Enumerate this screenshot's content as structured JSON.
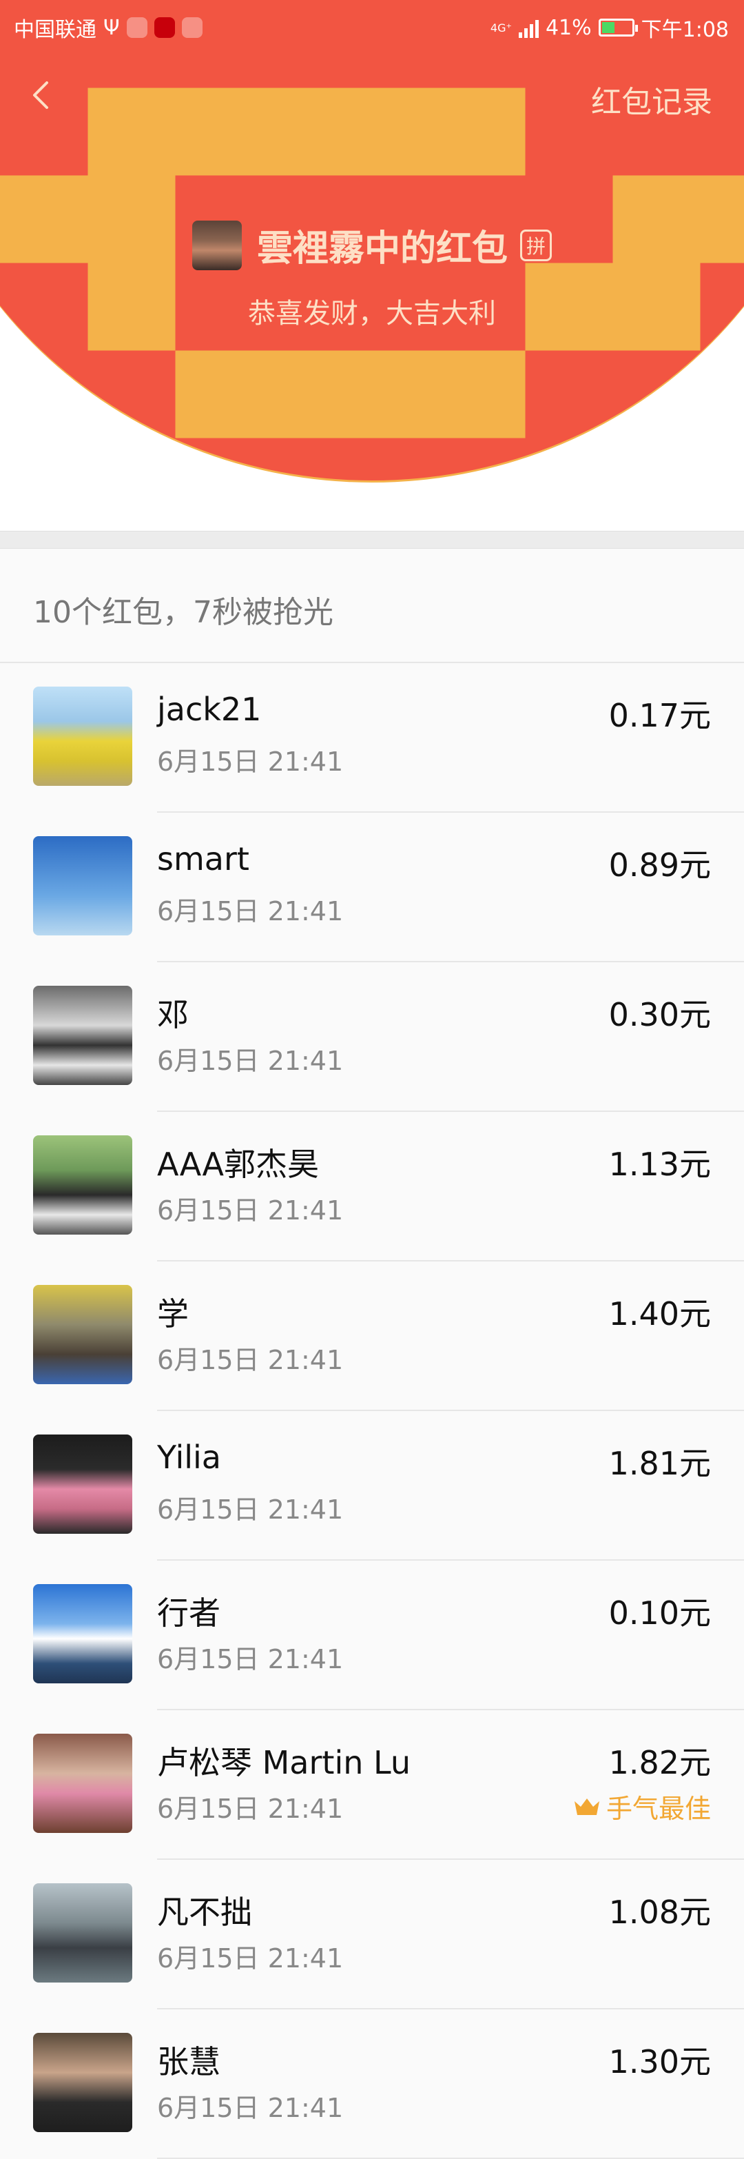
{
  "status_bar": {
    "carrier": "中国联通",
    "usb": "Ψ",
    "network": "4G⁺",
    "battery": "41%",
    "time": "下午1:08"
  },
  "header": {
    "back_icon": "chevron-left-icon",
    "record_link": "红包记录",
    "sender_title": "雲裡霧中的红包",
    "pin_badge": "拼",
    "greeting": "恭喜发财，大吉大利"
  },
  "summary": "10个红包，7秒被抢光",
  "colors": {
    "header_red": "#f25542",
    "header_text": "#fde0c6",
    "best_luck": "#f2a733"
  },
  "records": [
    {
      "name": "jack21",
      "time": "6月15日  21:41",
      "amount": "0.17元",
      "best": ""
    },
    {
      "name": "smart",
      "time": "6月15日  21:41",
      "amount": "0.89元",
      "best": ""
    },
    {
      "name": "邓",
      "time": "6月15日  21:41",
      "amount": "0.30元",
      "best": ""
    },
    {
      "name": "AAA郭杰昊",
      "time": "6月15日  21:41",
      "amount": "1.13元",
      "best": ""
    },
    {
      "name": "学",
      "time": "6月15日  21:41",
      "amount": "1.40元",
      "best": ""
    },
    {
      "name": "Yilia",
      "time": "6月15日  21:41",
      "amount": "1.81元",
      "best": ""
    },
    {
      "name": "行者",
      "time": "6月15日  21:41",
      "amount": "0.10元",
      "best": ""
    },
    {
      "name": "卢松琴 Martin Lu",
      "time": "6月15日  21:41",
      "amount": "1.82元",
      "best": "手气最佳"
    },
    {
      "name": "凡不拙",
      "time": "6月15日  21:41",
      "amount": "1.08元",
      "best": ""
    },
    {
      "name": "张慧",
      "time": "6月15日  21:41",
      "amount": "1.30元",
      "best": ""
    }
  ]
}
